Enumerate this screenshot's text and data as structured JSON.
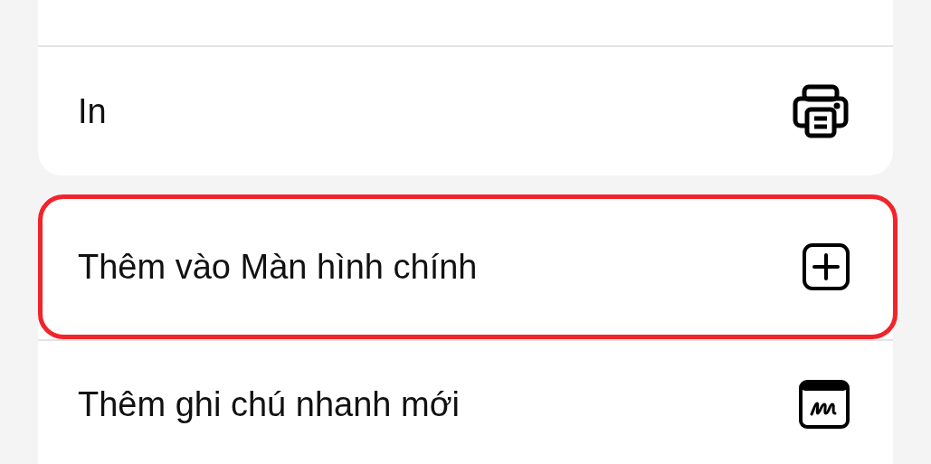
{
  "groups": [
    {
      "items": [
        {
          "label": "In",
          "kind": "printer",
          "highlighted": false
        }
      ]
    },
    {
      "items": [
        {
          "label": "Thêm vào Màn hình chính",
          "kind": "add-square",
          "highlighted": true
        },
        {
          "label": "Thêm ghi chú nhanh mới",
          "kind": "quick-note",
          "highlighted": false
        }
      ]
    }
  ]
}
